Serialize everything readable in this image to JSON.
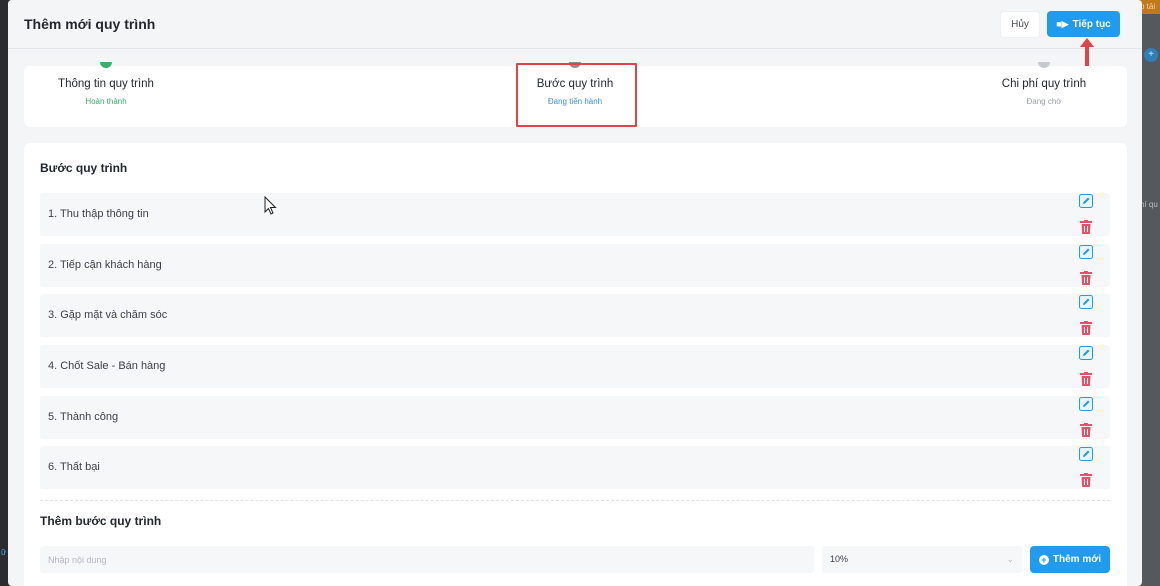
{
  "background": {
    "right_top_text": "p tải",
    "right_icon": "+",
    "right_side_text": "hí qu",
    "left_edge_text": "ữ"
  },
  "modal": {
    "title": "Thêm mới quy trình",
    "cancel_label": "Hủy",
    "next_label": "Tiếp tục"
  },
  "steps": [
    {
      "name": "Thông tin quy trình",
      "status": "Hoàn thành"
    },
    {
      "name": "Bước quy trình",
      "status": "Đang tiến hành"
    },
    {
      "name": "Chi phí quy trình",
      "status": "Đang chờ"
    }
  ],
  "process_steps": {
    "title": "Bước quy trình",
    "items": [
      {
        "label": "1. Thu thập thông tin"
      },
      {
        "label": "2. Tiếp cận khách hàng"
      },
      {
        "label": "3. Gặp mặt và chăm sóc"
      },
      {
        "label": "4. Chốt Sale - Bán hàng"
      },
      {
        "label": "5. Thành công"
      },
      {
        "label": "6. Thất bại"
      }
    ]
  },
  "add_step": {
    "title": "Thêm bước quy trình",
    "content_placeholder": "Nhập nội dung",
    "percent_value": "10%",
    "add_label": "Thêm mới"
  },
  "colors": {
    "primary": "#1f9bf0",
    "done": "#35b36b",
    "in_progress": "#3b8fe0",
    "delete": "#e8506a",
    "highlight": "#e0434a"
  },
  "icons": {
    "next": "arrow-right-icon",
    "edit": "pencil-icon",
    "delete": "trash-icon",
    "add": "plus-circle-icon"
  }
}
